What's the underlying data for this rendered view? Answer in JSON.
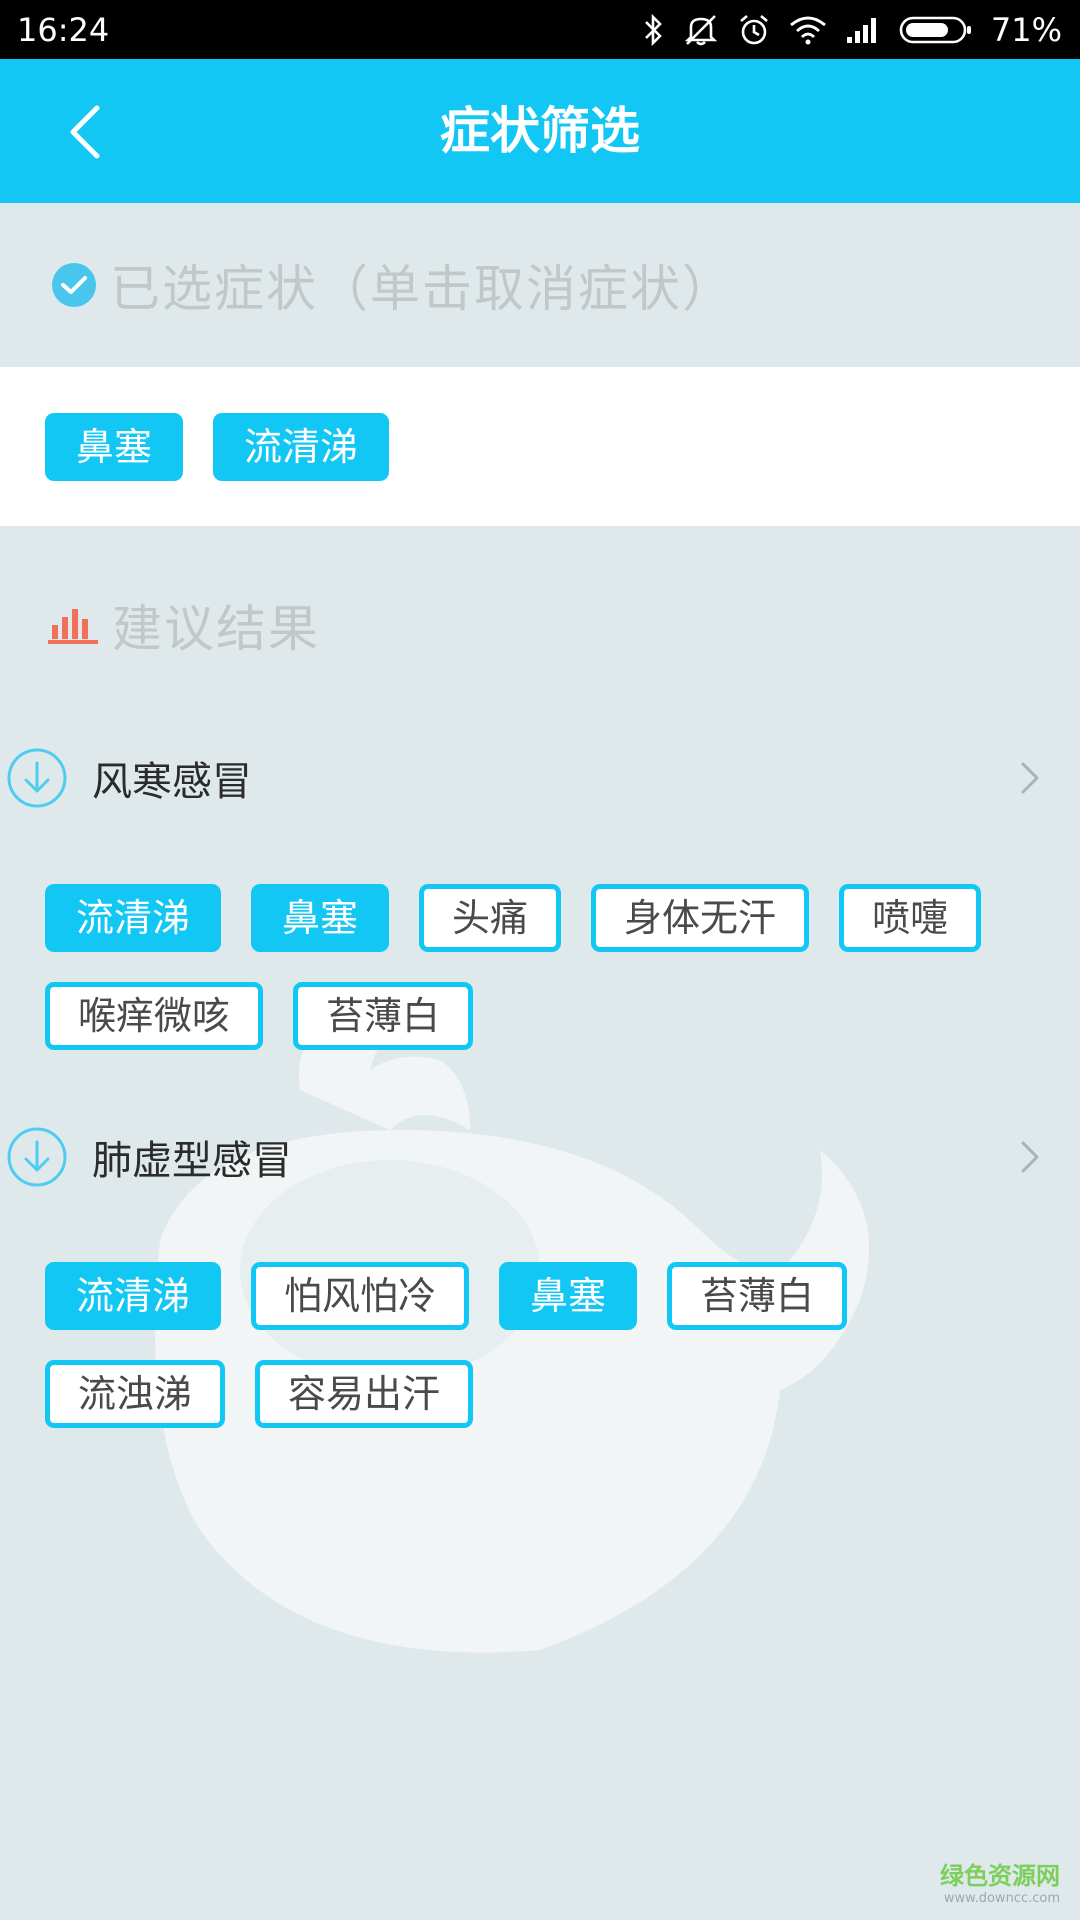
{
  "status_bar": {
    "time": "16:24",
    "battery": "71%",
    "icons": [
      "bluetooth-icon",
      "mute-icon",
      "alarm-icon",
      "wifi-icon",
      "signal-icon",
      "battery-icon"
    ]
  },
  "header": {
    "title": "症状筛选",
    "back_icon": "chevron-left-icon"
  },
  "selected": {
    "title": "已选症状（单击取消症状）",
    "chips": [
      "鼻塞",
      "流清涕"
    ]
  },
  "results": {
    "title": "建议结果",
    "diseases": [
      {
        "name": "风寒感冒",
        "symptoms": [
          {
            "label": "流清涕",
            "selected": true
          },
          {
            "label": "鼻塞",
            "selected": true
          },
          {
            "label": "头痛",
            "selected": false
          },
          {
            "label": "身体无汗",
            "selected": false
          },
          {
            "label": "喷嚏",
            "selected": false
          },
          {
            "label": "喉痒微咳",
            "selected": false
          },
          {
            "label": "苔薄白",
            "selected": false
          }
        ]
      },
      {
        "name": "肺虚型感冒",
        "symptoms": [
          {
            "label": "流清涕",
            "selected": true
          },
          {
            "label": "怕风怕冷",
            "selected": false
          },
          {
            "label": "鼻塞",
            "selected": true
          },
          {
            "label": "苔薄白",
            "selected": false
          },
          {
            "label": "流浊涕",
            "selected": false
          },
          {
            "label": "容易出汗",
            "selected": false
          }
        ]
      }
    ]
  },
  "footer": {
    "site_name": "绿色资源网",
    "site_url": "www.downcc.com"
  },
  "colors": {
    "accent": "#13c7f4",
    "background": "#dfe9ec",
    "chart_icon": "#f0705a"
  }
}
